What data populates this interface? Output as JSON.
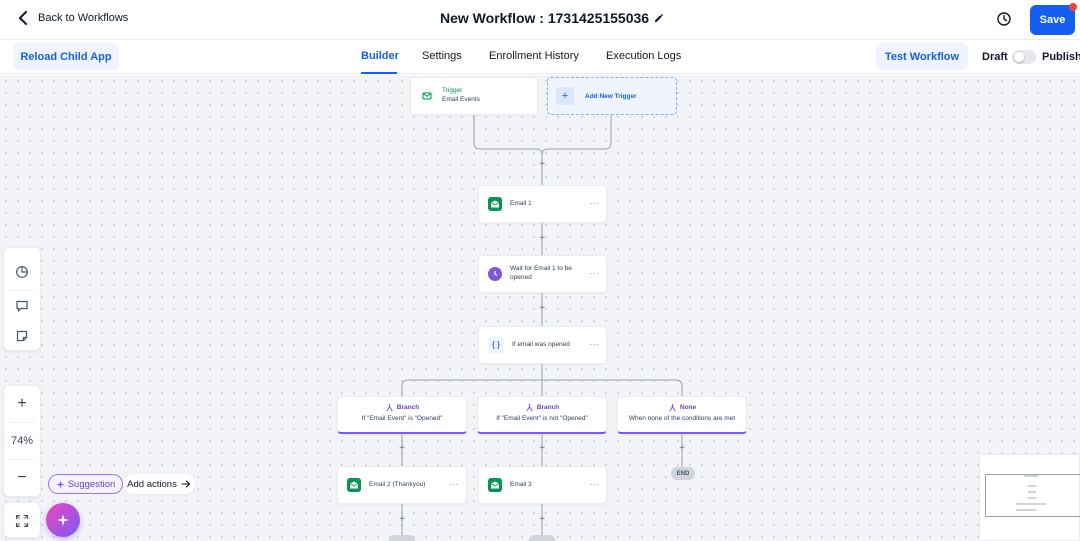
{
  "header": {
    "back_label": "Back to Workflows",
    "title": "New Workflow : 1731425155036",
    "save_label": "Save"
  },
  "subheader": {
    "reload_label": "Reload Child App",
    "tabs": [
      {
        "label": "Builder",
        "active": true
      },
      {
        "label": "Settings",
        "active": false
      },
      {
        "label": "Enrollment History",
        "active": false
      },
      {
        "label": "Execution Logs",
        "active": false
      }
    ],
    "test_label": "Test Workflow",
    "draft_label": "Draft",
    "publish_label": "Publish",
    "published": false
  },
  "trigger": {
    "title": "Trigger",
    "subtitle": "Email Events",
    "add_label": "Add New Trigger"
  },
  "steps": [
    {
      "label": "Email 1",
      "icon": "mail-icon"
    },
    {
      "label": "Wait for Email 1 to be opened",
      "icon": "clock-icon"
    },
    {
      "label": "If email was opened",
      "icon": "code-braces-icon"
    }
  ],
  "branches": [
    {
      "title": "Branch",
      "condition": "If \"Email Event\" is \"Opened\""
    },
    {
      "title": "Branch",
      "condition": "If \"Email Event\" is not \"Opened\""
    },
    {
      "title": "None",
      "condition": "When none of the conditions are met"
    }
  ],
  "branch_steps": [
    {
      "label": "Email 2 (Thankyou)",
      "icon": "mail-icon"
    },
    {
      "label": "Email 3",
      "icon": "mail-icon"
    }
  ],
  "end_label": "END",
  "step_menu": "···",
  "zoom": {
    "level_label": "74%",
    "zoom_in": "+",
    "zoom_out": "−"
  },
  "assist": {
    "suggestion_label": "Suggestion",
    "add_actions_label": "Add actions"
  },
  "colors": {
    "primary": "#155eef",
    "branch_accent": "#7a5af8",
    "email_green": "#079455",
    "wait_purple": "#7f56d9",
    "ai_gradient_start": "#ee46bc",
    "ai_gradient_end": "#7a5af8"
  }
}
